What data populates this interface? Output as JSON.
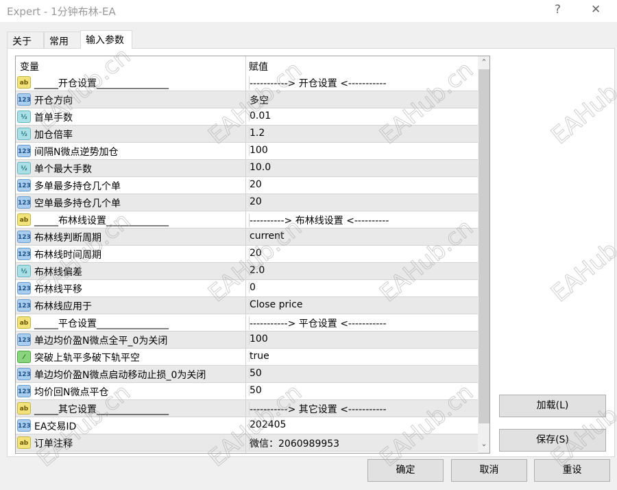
{
  "window": {
    "title": "Expert - 1分钟布林-EA",
    "help": "?",
    "close": "✕"
  },
  "tabs": [
    {
      "label": "关于"
    },
    {
      "label": "常用"
    },
    {
      "label": "输入参数"
    }
  ],
  "table": {
    "headers": {
      "name": "变量",
      "value": "赋值"
    },
    "rows": [
      {
        "type": "str",
        "icon": "ab",
        "name": "_____开仓设置_______________",
        "value": "-----------> 开仓设置 <-----------"
      },
      {
        "type": "int",
        "icon": "123",
        "name": "开仓方向",
        "value": "多空"
      },
      {
        "type": "dbl",
        "icon": "½",
        "name": "首单手数",
        "value": "0.01"
      },
      {
        "type": "dbl",
        "icon": "½",
        "name": "加仓倍率",
        "value": "1.2"
      },
      {
        "type": "int",
        "icon": "123",
        "name": "间隔N微点逆势加仓",
        "value": "100"
      },
      {
        "type": "dbl",
        "icon": "½",
        "name": "单个最大手数",
        "value": "10.0"
      },
      {
        "type": "int",
        "icon": "123",
        "name": "多单最多持仓几个单",
        "value": "20"
      },
      {
        "type": "int",
        "icon": "123",
        "name": "空单最多持仓几个单",
        "value": "20"
      },
      {
        "type": "str",
        "icon": "ab",
        "name": "_____布林线设置_____________",
        "value": "----------> 布林线设置 <----------"
      },
      {
        "type": "int",
        "icon": "123",
        "name": "布林线判断周期",
        "value": "current"
      },
      {
        "type": "int",
        "icon": "123",
        "name": "布林线时间周期",
        "value": "20"
      },
      {
        "type": "dbl",
        "icon": "½",
        "name": "布林线偏差",
        "value": "2.0"
      },
      {
        "type": "int",
        "icon": "123",
        "name": "布林线平移",
        "value": "0"
      },
      {
        "type": "int",
        "icon": "123",
        "name": "布林线应用于",
        "value": "Close price"
      },
      {
        "type": "str",
        "icon": "ab",
        "name": "_____平仓设置_______________",
        "value": "-----------> 平仓设置 <-----------"
      },
      {
        "type": "int",
        "icon": "123",
        "name": "单边均价盈N微点全平_0为关闭",
        "value": "100"
      },
      {
        "type": "bool",
        "icon": "⁄",
        "name": "突破上轨平多破下轨平空",
        "value": "true"
      },
      {
        "type": "int",
        "icon": "123",
        "name": "单边均价盈N微点启动移动止损_0为关闭",
        "value": "50"
      },
      {
        "type": "int",
        "icon": "123",
        "name": "均价回N微点平仓",
        "value": "50"
      },
      {
        "type": "str",
        "icon": "ab",
        "name": "_____其它设置_______________",
        "value": "-----------> 其它设置 <-----------"
      },
      {
        "type": "int",
        "icon": "123",
        "name": "EA交易ID",
        "value": "202405"
      },
      {
        "type": "str",
        "icon": "ab",
        "name": "订单注释",
        "value": "微信：2060989953"
      }
    ]
  },
  "buttons": {
    "load": "加载(L)",
    "save": "保存(S)",
    "ok": "确定",
    "cancel": "取消",
    "reset": "重设"
  },
  "scrollbar": {
    "up": "⌃",
    "down": "⌄"
  },
  "watermark": "EAHub.cn"
}
